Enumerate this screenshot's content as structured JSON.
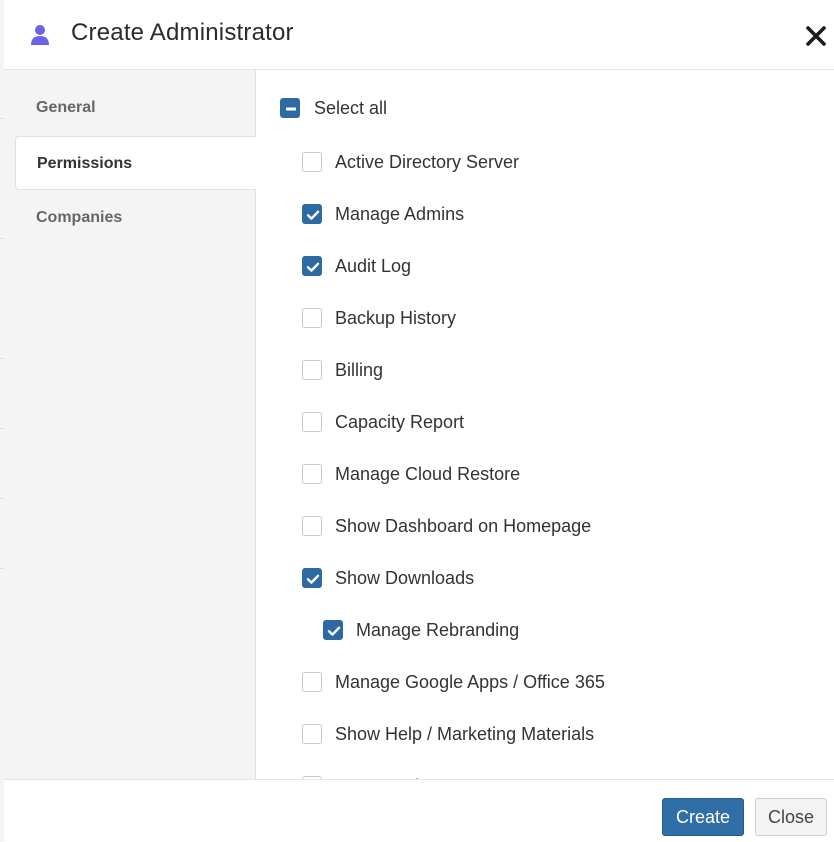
{
  "dialog": {
    "title": "Create Administrator",
    "accent_color": "#2d6aa3",
    "icon": "user-icon"
  },
  "tabs": [
    {
      "label": "General",
      "active": false
    },
    {
      "label": "Permissions",
      "active": true
    },
    {
      "label": "Companies",
      "active": false
    }
  ],
  "permissions": {
    "select_all": {
      "label": "Select all",
      "state": "partial"
    },
    "items": [
      {
        "label": "Active Directory Server",
        "checked": false,
        "indent": 0
      },
      {
        "label": "Manage Admins",
        "checked": true,
        "indent": 0
      },
      {
        "label": "Audit Log",
        "checked": true,
        "indent": 0
      },
      {
        "label": "Backup History",
        "checked": false,
        "indent": 0
      },
      {
        "label": "Billing",
        "checked": false,
        "indent": 0
      },
      {
        "label": "Capacity Report",
        "checked": false,
        "indent": 0
      },
      {
        "label": "Manage Cloud Restore",
        "checked": false,
        "indent": 0
      },
      {
        "label": "Show Dashboard on Homepage",
        "checked": false,
        "indent": 0
      },
      {
        "label": "Show Downloads",
        "checked": true,
        "indent": 0
      },
      {
        "label": "Manage Rebranding",
        "checked": true,
        "indent": 1
      },
      {
        "label": "Manage Google Apps / Office 365",
        "checked": false,
        "indent": 0
      },
      {
        "label": "Show Help / Marketing Materials",
        "checked": false,
        "indent": 0
      },
      {
        "label": "Manage Licenses",
        "checked": false,
        "indent": 0
      }
    ]
  },
  "footer": {
    "create_label": "Create",
    "close_label": "Close"
  }
}
